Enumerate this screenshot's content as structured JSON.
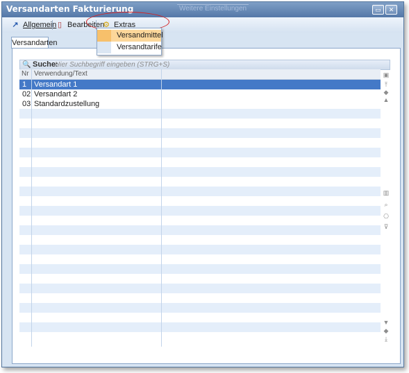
{
  "window": {
    "title": "Versandarten Fakturierung",
    "ghost_title": "Weitere Einstellungen"
  },
  "toolbar": {
    "allgemein": "Allgemein",
    "bearbeiten": "Bearbeiten",
    "extras": "Extras"
  },
  "menu": {
    "items": [
      "Versandmittel",
      "Versandtarife"
    ],
    "highlighted_index": 0
  },
  "tab": {
    "label": "Versandarten"
  },
  "search": {
    "label": "Suche:",
    "placeholder": "Hier Suchbegriff eingeben (STRG+S)"
  },
  "grid": {
    "columns": [
      "Nr",
      "Verwendung/Text"
    ],
    "rows": [
      {
        "nr": "1",
        "text": "Versandart 1",
        "selected": true
      },
      {
        "nr": "02",
        "text": "Versandart 2"
      },
      {
        "nr": "03",
        "text": "Standardzustellung"
      }
    ]
  },
  "colors": {
    "selection": "#4479c7",
    "highlight_menu": "#fcd79a",
    "annotation_oval": "#d62020"
  }
}
